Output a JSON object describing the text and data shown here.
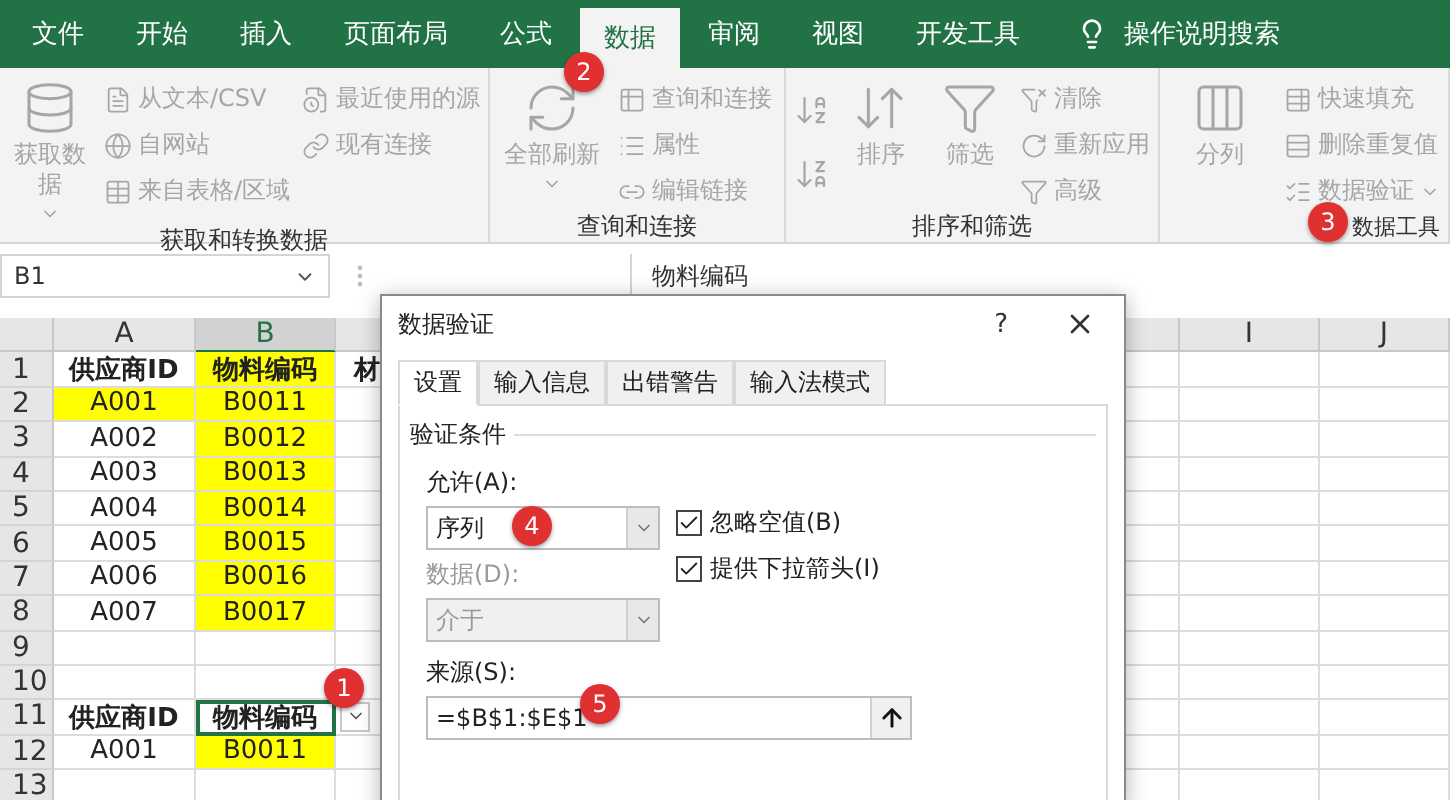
{
  "menu_tabs": [
    {
      "label": "文件",
      "selected": false
    },
    {
      "label": "开始",
      "selected": false
    },
    {
      "label": "插入",
      "selected": false
    },
    {
      "label": "页面布局",
      "selected": false
    },
    {
      "label": "公式",
      "selected": false
    },
    {
      "label": "数据",
      "selected": true
    },
    {
      "label": "审阅",
      "selected": false
    },
    {
      "label": "视图",
      "selected": false
    },
    {
      "label": "开发工具",
      "selected": false
    }
  ],
  "search": "操作说明搜索",
  "ribbon": [
    {
      "label": "获取和转换数据",
      "items": [
        {
          "kind": "large",
          "label": "获取数据",
          "dropdown": true
        },
        {
          "kind": "stack",
          "entries": [
            {
              "label": "从文本/CSV",
              "dropdown": false
            },
            {
              "label": "自网站",
              "dropdown": false
            },
            {
              "label": "来自表格/区域",
              "dropdown": false
            }
          ]
        },
        {
          "kind": "stack",
          "entries": [
            {
              "label": "最近使用的源",
              "dropdown": false
            },
            {
              "label": "现有连接",
              "dropdown": false
            }
          ]
        }
      ]
    },
    {
      "label": "查询和连接",
      "items": [
        {
          "kind": "large",
          "label": "全部刷新",
          "dropdown": true
        },
        {
          "kind": "stack",
          "entries": [
            {
              "label": "查询和连接",
              "dropdown": false
            },
            {
              "label": "属性",
              "dropdown": false
            },
            {
              "label": "编辑链接",
              "dropdown": false
            }
          ]
        }
      ]
    },
    {
      "label": "排序和筛选",
      "items": [
        {
          "kind": "sort-icons"
        },
        {
          "kind": "large",
          "label": "排序",
          "dropdown": false
        },
        {
          "kind": "large",
          "label": "筛选",
          "dropdown": false
        },
        {
          "kind": "stack",
          "entries": [
            {
              "label": "清除",
              "dropdown": false
            },
            {
              "label": "重新应用",
              "dropdown": false
            },
            {
              "label": "高级",
              "dropdown": false
            }
          ]
        }
      ]
    },
    {
      "label": "数据工具",
      "items": [
        {
          "kind": "large",
          "label": "分列",
          "dropdown": false
        },
        {
          "kind": "stack",
          "entries": [
            {
              "label": "快速填充",
              "dropdown": false
            },
            {
              "label": "删除重复值",
              "dropdown": false
            },
            {
              "label": "数据验证",
              "dropdown": true
            }
          ]
        }
      ]
    }
  ],
  "name_box": "B1",
  "formula": "物料编码",
  "columns": [
    {
      "label": "A",
      "selected": false
    },
    {
      "label": "B",
      "selected": true
    },
    {
      "label": "I",
      "selected": false
    },
    {
      "label": "J",
      "selected": false
    }
  ],
  "rows": [
    {
      "number": "1",
      "bold": true,
      "cells": [
        {
          "text": "供应商ID",
          "highlighted": false,
          "selected": false
        },
        {
          "text": "物料编码",
          "highlighted": true,
          "selected": false
        },
        {
          "text": "材",
          "highlighted": false,
          "selected": false
        }
      ]
    },
    {
      "number": "2",
      "bold": false,
      "cells": [
        {
          "text": "A001",
          "highlighted": true,
          "selected": false
        },
        {
          "text": "B0011",
          "highlighted": true,
          "selected": false
        }
      ]
    },
    {
      "number": "3",
      "bold": false,
      "cells": [
        {
          "text": "A002",
          "highlighted": false,
          "selected": false
        },
        {
          "text": "B0012",
          "highlighted": true,
          "selected": false
        }
      ]
    },
    {
      "number": "4",
      "bold": false,
      "cells": [
        {
          "text": "A003",
          "highlighted": false,
          "selected": false
        },
        {
          "text": "B0013",
          "highlighted": true,
          "selected": false
        }
      ]
    },
    {
      "number": "5",
      "bold": false,
      "cells": [
        {
          "text": "A004",
          "highlighted": false,
          "selected": false
        },
        {
          "text": "B0014",
          "highlighted": true,
          "selected": false
        }
      ]
    },
    {
      "number": "6",
      "bold": false,
      "cells": [
        {
          "text": "A005",
          "highlighted": false,
          "selected": false
        },
        {
          "text": "B0015",
          "highlighted": true,
          "selected": false
        }
      ]
    },
    {
      "number": "7",
      "bold": false,
      "cells": [
        {
          "text": "A006",
          "highlighted": false,
          "selected": false
        },
        {
          "text": "B0016",
          "highlighted": true,
          "selected": false
        }
      ]
    },
    {
      "number": "8",
      "bold": false,
      "cells": [
        {
          "text": "A007",
          "highlighted": false,
          "selected": false
        },
        {
          "text": "B0017",
          "highlighted": true,
          "selected": false
        }
      ]
    },
    {
      "number": "9",
      "cells": []
    },
    {
      "number": "10",
      "cells": []
    },
    {
      "number": "11",
      "bold": true,
      "cells": [
        {
          "text": "供应商ID",
          "highlighted": false,
          "selected": false
        },
        {
          "text": "物料编码",
          "highlighted": false,
          "selected": true,
          "dropdown": true
        }
      ]
    },
    {
      "number": "12",
      "bold": false,
      "cells": [
        {
          "text": "A001",
          "highlighted": false,
          "selected": false
        },
        {
          "text": "B0011",
          "highlighted": true,
          "selected": false
        }
      ]
    },
    {
      "number": "13",
      "cells": []
    }
  ],
  "dialog": {
    "title": "数据验证",
    "help": "?",
    "tabs": [
      {
        "label": "设置",
        "selected": true
      },
      {
        "label": "输入信息",
        "selected": false
      },
      {
        "label": "出错警告",
        "selected": false
      },
      {
        "label": "输入法模式",
        "selected": false
      }
    ],
    "section": "验证条件",
    "allow": {
      "label": "允许(A):",
      "value": "序列",
      "disabled": false
    },
    "data": {
      "label": "数据(D):",
      "value": "介于",
      "disabled": true
    },
    "checkboxes": [
      {
        "label": "忽略空值(B)",
        "checked": true
      },
      {
        "label": "提供下拉箭头(I)",
        "checked": true
      }
    ],
    "source": {
      "label": "来源(S):",
      "value": "=$B$1:$E$1"
    }
  },
  "callouts": [
    "1",
    "2",
    "3",
    "4",
    "5"
  ]
}
